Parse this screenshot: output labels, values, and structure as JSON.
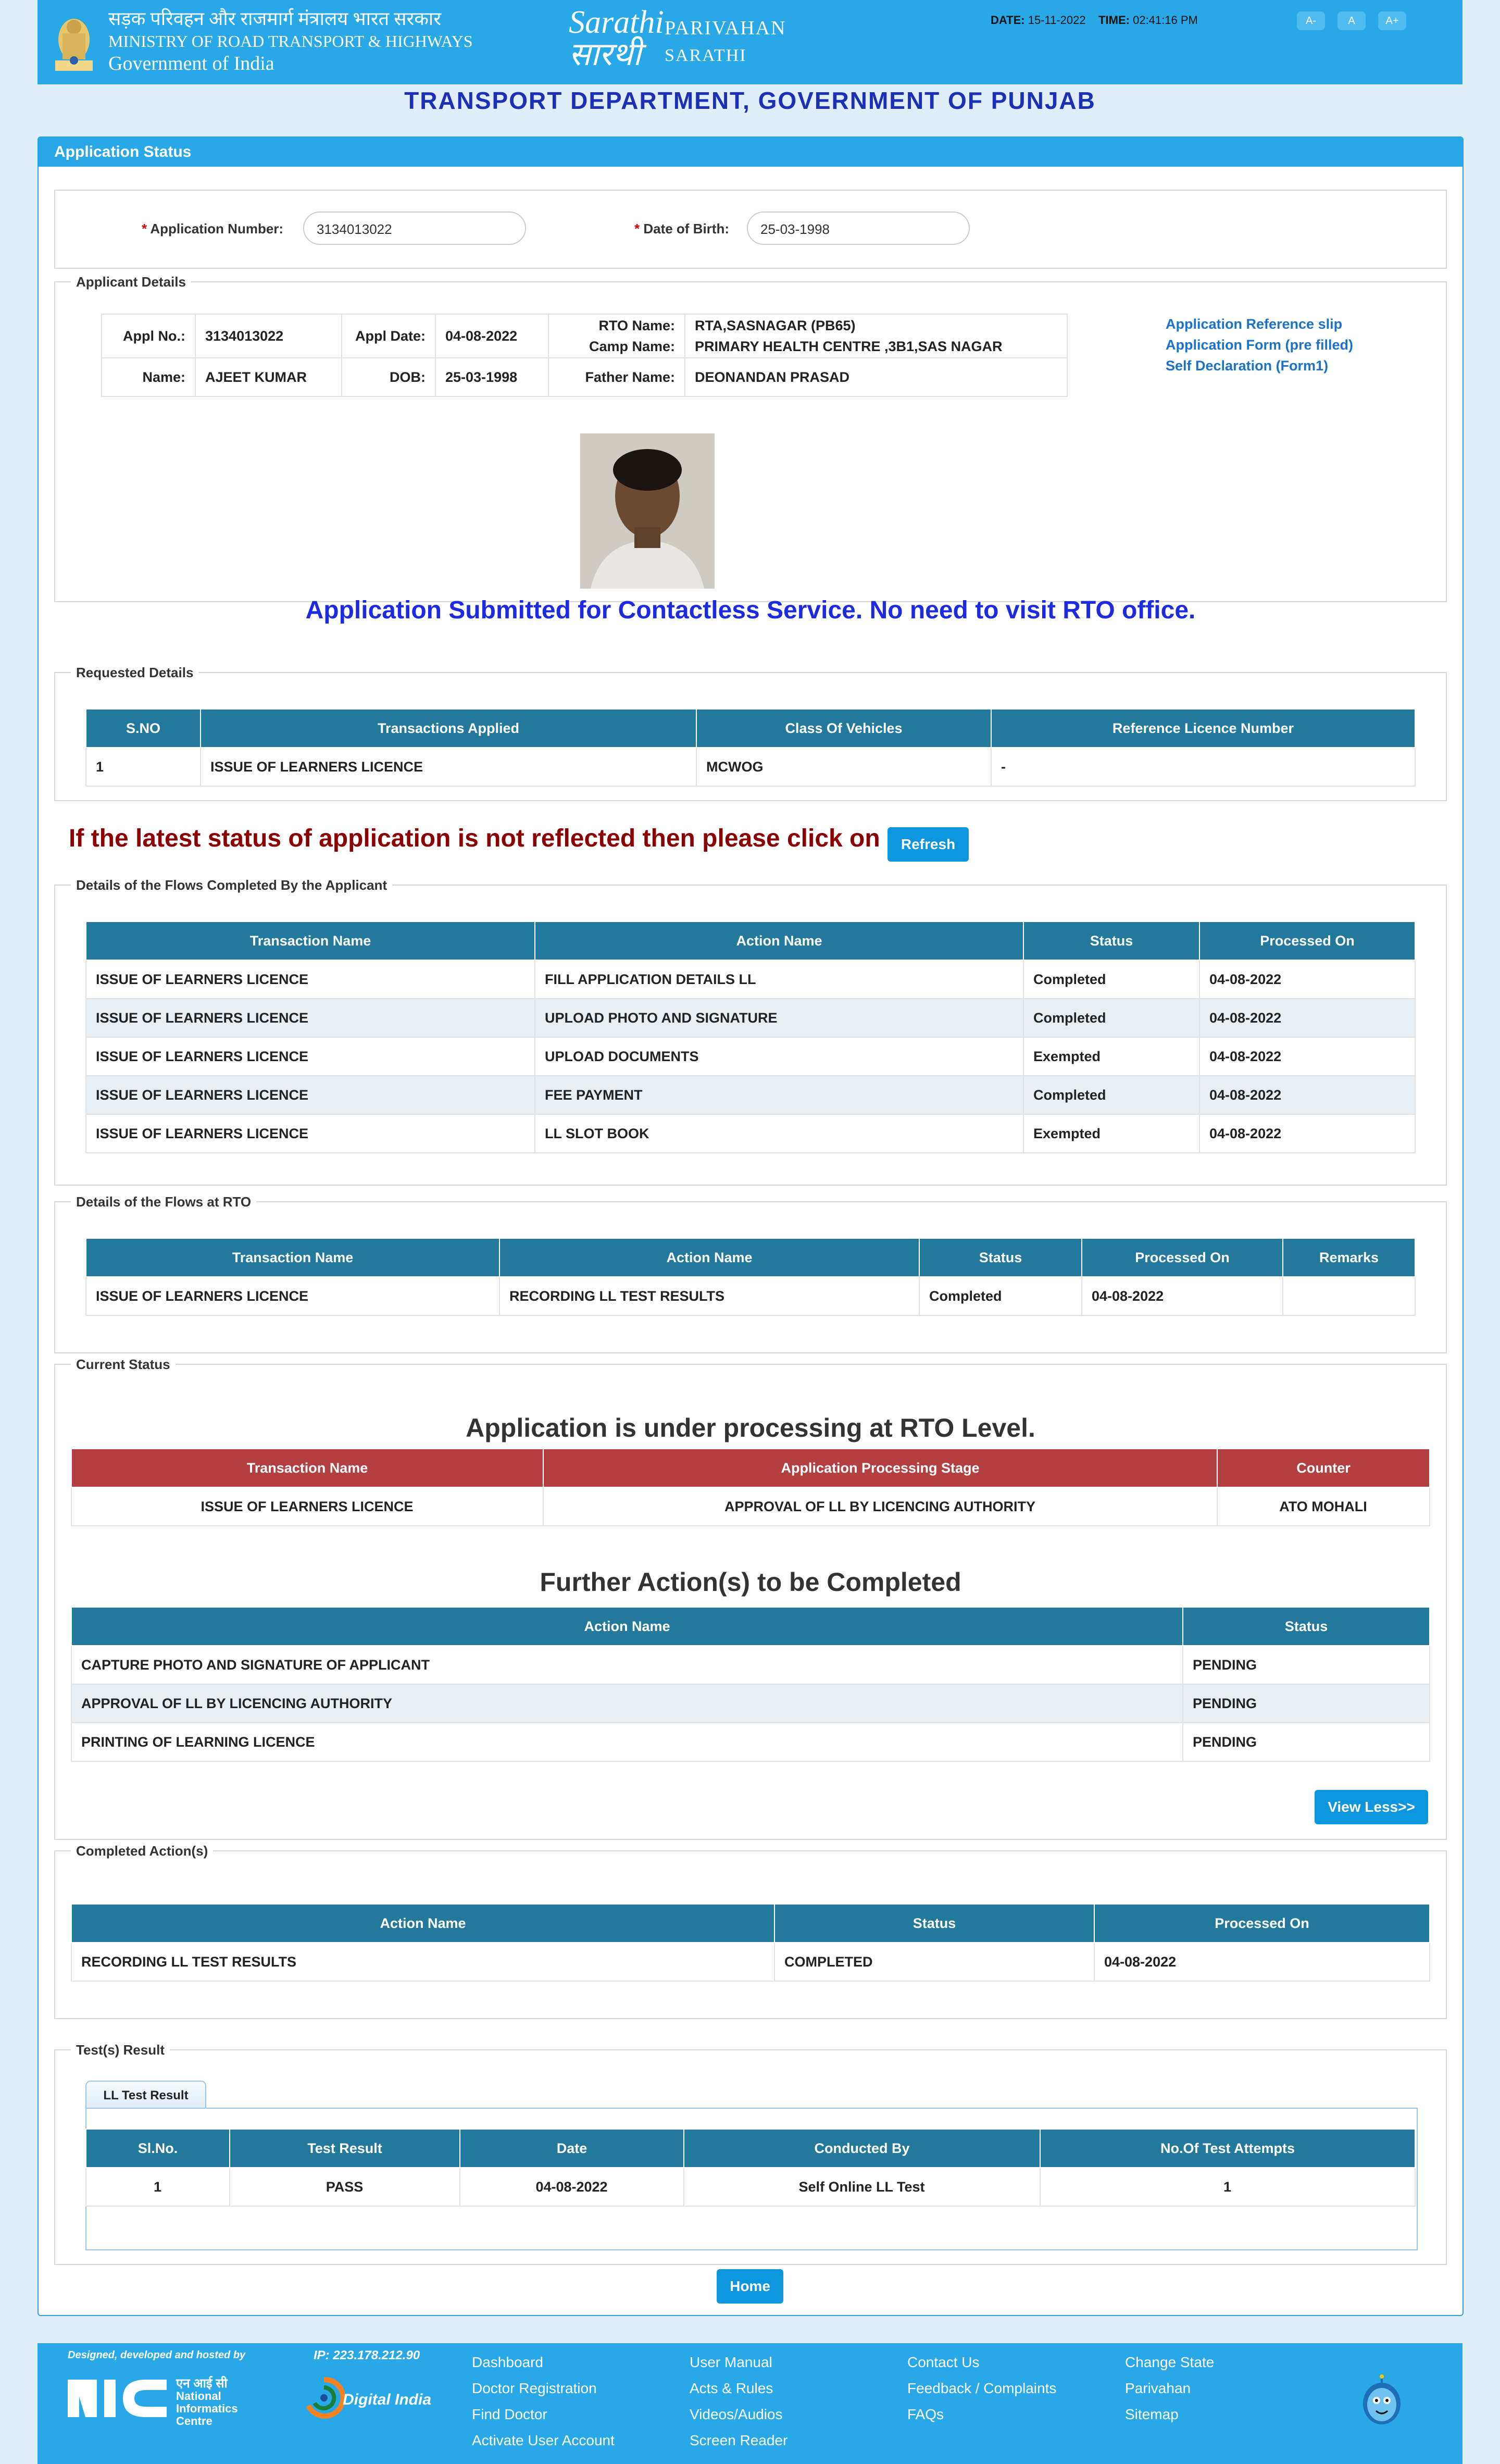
{
  "header": {
    "hindi_line": "सड़क परिवहन और राजमार्ग मंत्रालय भारत सरकार",
    "ministry": "MINISTRY OF ROAD TRANSPORT & HIGHWAYS",
    "govt": "Government of India",
    "logo_text": "Sarathi सारथी",
    "parivahan": "PARIVAHAN",
    "sarathi": "SARATHI",
    "date_label": "DATE:",
    "date_value": "15-11-2022",
    "time_label": "TIME:",
    "time_value": "02:41:16 PM",
    "font_buttons": [
      "A-",
      "A",
      "A+"
    ]
  },
  "dept_title": "TRANSPORT DEPARTMENT, GOVERNMENT OF PUNJAB",
  "panel_title": "Application Status",
  "search": {
    "app_no_label": "Application Number:",
    "app_no_value": "3134013022",
    "dob_label": "Date of Birth:",
    "dob_value": "25-03-1998"
  },
  "applicant": {
    "legend": "Applicant Details",
    "appl_no_label": "Appl No.:",
    "appl_no": "3134013022",
    "appl_date_label": "Appl Date:",
    "appl_date": "04-08-2022",
    "rto_label": "RTO Name:",
    "rto": "RTA,SASNAGAR (PB65)",
    "camp_label": "Camp Name:",
    "camp": "PRIMARY HEALTH CENTRE ,3B1,SAS NAGAR",
    "name_label": "Name:",
    "name": "AJEET KUMAR",
    "dob_label": "DOB:",
    "dob": "25-03-1998",
    "father_label": "Father  Name:",
    "father": "DEONANDAN PRASAD",
    "links": [
      "Application Reference slip",
      "Application Form (pre filled)",
      "Self Declaration (Form1)"
    ]
  },
  "contactless_msg": "Application Submitted for Contactless Service. No need to visit RTO office.",
  "requested": {
    "legend": "Requested Details",
    "headers": [
      "S.NO",
      "Transactions Applied",
      "Class Of Vehicles",
      "Reference Licence Number"
    ],
    "rows": [
      [
        "1",
        "ISSUE OF LEARNERS LICENCE",
        "MCWOG",
        "-"
      ]
    ]
  },
  "refresh": {
    "text": "If the latest status of application is not reflected then please click on",
    "button": "Refresh"
  },
  "flows_applicant": {
    "legend": "Details of the Flows Completed By the Applicant",
    "headers": [
      "Transaction Name",
      "Action Name",
      "Status",
      "Processed On"
    ],
    "rows": [
      [
        "ISSUE OF LEARNERS LICENCE",
        "FILL APPLICATION DETAILS LL",
        "Completed",
        "04-08-2022"
      ],
      [
        "ISSUE OF LEARNERS LICENCE",
        "UPLOAD PHOTO AND SIGNATURE",
        "Completed",
        "04-08-2022"
      ],
      [
        "ISSUE OF LEARNERS LICENCE",
        "UPLOAD DOCUMENTS",
        "Exempted",
        "04-08-2022"
      ],
      [
        "ISSUE OF LEARNERS LICENCE",
        "FEE PAYMENT",
        "Completed",
        "04-08-2022"
      ],
      [
        "ISSUE OF LEARNERS LICENCE",
        "LL SLOT BOOK",
        "Exempted",
        "04-08-2022"
      ]
    ]
  },
  "flows_rto": {
    "legend": "Details of the Flows at RTO",
    "headers": [
      "Transaction Name",
      "Action Name",
      "Status",
      "Processed On",
      "Remarks"
    ],
    "rows": [
      [
        "ISSUE OF LEARNERS LICENCE",
        "RECORDING LL TEST RESULTS",
        "Completed",
        "04-08-2022",
        ""
      ]
    ]
  },
  "current": {
    "legend": "Current Status",
    "title": "Application is under processing at RTO Level.",
    "headers": [
      "Transaction Name",
      "Application Processing Stage",
      "Counter"
    ],
    "rows": [
      [
        "ISSUE OF LEARNERS LICENCE",
        "APPROVAL OF LL BY LICENCING AUTHORITY",
        "ATO MOHALI"
      ]
    ],
    "further_title": "Further Action(s) to be Completed",
    "further_headers": [
      "Action Name",
      "Status"
    ],
    "further_rows": [
      [
        "CAPTURE PHOTO AND SIGNATURE OF APPLICANT",
        "PENDING"
      ],
      [
        "APPROVAL OF LL BY LICENCING AUTHORITY",
        "PENDING"
      ],
      [
        "PRINTING OF LEARNING LICENCE",
        "PENDING"
      ]
    ],
    "view_less": "View Less>>"
  },
  "completed": {
    "legend": "Completed Action(s)",
    "headers": [
      "Action Name",
      "Status",
      "Processed On"
    ],
    "rows": [
      [
        "RECORDING LL TEST RESULTS",
        "COMPLETED",
        "04-08-2022"
      ]
    ]
  },
  "tests": {
    "legend": "Test(s) Result",
    "tab": "LL Test Result",
    "headers": [
      "Sl.No.",
      "Test Result",
      "Date",
      "Conducted By",
      "No.Of Test Attempts"
    ],
    "rows": [
      [
        "1",
        "PASS",
        "04-08-2022",
        "Self Online LL Test",
        "1"
      ]
    ]
  },
  "home_button": "Home",
  "footer": {
    "designed": "Designed, developed and hosted by",
    "ip": "IP: 223.178.212.90",
    "nic_hindi": "एन आई सी",
    "nic_lines": [
      "National",
      "Informatics",
      "Centre"
    ],
    "digital_india": "Digital India",
    "col1": [
      "Dashboard",
      "Doctor Registration",
      "Find Doctor",
      "Activate User Account"
    ],
    "col2": [
      "User Manual",
      "Acts & Rules",
      "Videos/Audios",
      "Screen Reader"
    ],
    "col3": [
      "Contact Us",
      "Feedback / Complaints",
      "FAQs"
    ],
    "col4": [
      "Change State",
      "Parivahan",
      "Sitemap"
    ]
  }
}
